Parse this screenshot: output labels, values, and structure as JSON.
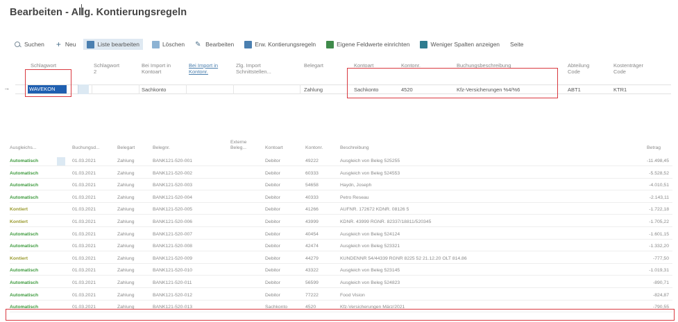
{
  "page": {
    "title": "Bearbeiten - Allg. Kontierungsregeln"
  },
  "toolbar": {
    "items": [
      {
        "label": "Suchen",
        "icon": "search-icon"
      },
      {
        "label": "Neu",
        "icon": "plus-icon"
      },
      {
        "label": "Liste bearbeiten",
        "icon": "edit-list-icon"
      },
      {
        "label": "Löschen",
        "icon": "delete-icon"
      },
      {
        "label": "Bearbeiten",
        "icon": "pencil-icon"
      },
      {
        "label": "Erw. Kontierungsregeln",
        "icon": "rules-icon"
      },
      {
        "label": "Eigene Feldwerte einrichten",
        "icon": "fields-icon"
      },
      {
        "label": "Weniger Spalten anzeigen",
        "icon": "columns-icon"
      },
      {
        "label": "Seite",
        "icon": ""
      }
    ]
  },
  "rules_table": {
    "headers": [
      "Schlagwort",
      "Schlagwort 2",
      "Bei Import in Kontoart",
      "Bei Import in Kontonr.",
      "Zlg. Import Schnittstellen...",
      "Belegart",
      "Kontoart",
      "Kontonr.",
      "Buchungsbeschreibung",
      "Abteilung Code",
      "Kostenträger Code"
    ],
    "row": {
      "schlagwort": "WAVEKON",
      "schlagwort2": "",
      "import_kontoart": "Sachkonto",
      "import_kontonr": "",
      "zlg_import": "",
      "belegart": "Zahlung",
      "kontoart": "Sachkonto",
      "kontonr": "4520",
      "beschreibung": "Kfz-Versicherungen %4/%6",
      "abteilung": "ABT1",
      "kostentraeger": "KTR1"
    }
  },
  "journal_table": {
    "headers": [
      "Ausgleichs...",
      "Buchungsd...",
      "Belegart",
      "Belegnr.",
      "Externe Beleg...",
      "Kontoart",
      "Kontonr.",
      "Beschreibung",
      "Betrag"
    ],
    "rows": [
      {
        "ausgleich": "Automatisch",
        "datum": "01.03.2021",
        "belegart": "Zahlung",
        "belegnr": "BANK121-520-001",
        "kontoart": "Debitor",
        "kontonr": "49222",
        "beschreibung": "Ausgleich von Beleg 525255",
        "betrag": "-11.498,45",
        "style": "green"
      },
      {
        "ausgleich": "Automatisch",
        "datum": "01.03.2021",
        "belegart": "Zahlung",
        "belegnr": "BANK121-520-002",
        "kontoart": "Debitor",
        "kontonr": "60333",
        "beschreibung": "Ausgleich von Beleg 524553",
        "betrag": "-5.528,52",
        "style": "green"
      },
      {
        "ausgleich": "Automatisch",
        "datum": "01.03.2021",
        "belegart": "Zahlung",
        "belegnr": "BANK121-520-003",
        "kontoart": "Debitor",
        "kontonr": "54658",
        "beschreibung": "Haydn, Joseph",
        "betrag": "-4.010,51",
        "style": "green"
      },
      {
        "ausgleich": "Automatisch",
        "datum": "01.03.2021",
        "belegart": "Zahlung",
        "belegnr": "BANK121-520-004",
        "kontoart": "Debitor",
        "kontonr": "40333",
        "beschreibung": "Petro Reseau",
        "betrag": "-2.143,11",
        "style": "green"
      },
      {
        "ausgleich": "Kontiert",
        "datum": "01.03.2021",
        "belegart": "Zahlung",
        "belegnr": "BANK121-520-005",
        "kontoart": "Debitor",
        "kontonr": "41266",
        "beschreibung": "AUFNR. 172672 KDNR. 08126 5",
        "betrag": "-1.722,18",
        "style": "olive"
      },
      {
        "ausgleich": "Kontiert",
        "datum": "01.03.2021",
        "belegart": "Zahlung",
        "belegnr": "BANK121-520-006",
        "kontoart": "Debitor",
        "kontonr": "43999",
        "beschreibung": "KDNR. 43999 RGNR. 82337/18811/520345",
        "betrag": "-1.705,22",
        "style": "olive"
      },
      {
        "ausgleich": "Automatisch",
        "datum": "01.03.2021",
        "belegart": "Zahlung",
        "belegnr": "BANK121-520-007",
        "kontoart": "Debitor",
        "kontonr": "40454",
        "beschreibung": "Ausgleich von Beleg 524124",
        "betrag": "-1.601,15",
        "style": "green"
      },
      {
        "ausgleich": "Automatisch",
        "datum": "01.03.2021",
        "belegart": "Zahlung",
        "belegnr": "BANK121-520-008",
        "kontoart": "Debitor",
        "kontonr": "42474",
        "beschreibung": "Ausgleich von Beleg 523321",
        "betrag": "-1.332,20",
        "style": "green"
      },
      {
        "ausgleich": "Kontiert",
        "datum": "01.03.2021",
        "belegart": "Zahlung",
        "belegnr": "BANK121-520-009",
        "kontoart": "Debitor",
        "kontonr": "44279",
        "beschreibung": "KUNDENNR 54/44339 RGNR 8225 52 21.12.20 OLT 814.86",
        "betrag": "-777,50",
        "style": "olive"
      },
      {
        "ausgleich": "Automatisch",
        "datum": "01.03.2021",
        "belegart": "Zahlung",
        "belegnr": "BANK121-520-010",
        "kontoart": "Debitor",
        "kontonr": "43322",
        "beschreibung": "Ausgleich von Beleg 523145",
        "betrag": "-1.019,31",
        "style": "green"
      },
      {
        "ausgleich": "Automatisch",
        "datum": "01.03.2021",
        "belegart": "Zahlung",
        "belegnr": "BANK121-520-011",
        "kontoart": "Debitor",
        "kontonr": "56599",
        "beschreibung": "Ausgleich von Beleg 524823",
        "betrag": "-890,71",
        "style": "green"
      },
      {
        "ausgleich": "Automatisch",
        "datum": "01.03.2021",
        "belegart": "Zahlung",
        "belegnr": "BANK121-520-012",
        "kontoart": "Debitor",
        "kontonr": "77222",
        "beschreibung": "Food Vision",
        "betrag": "-824,87",
        "style": "green"
      },
      {
        "ausgleich": "Automatisch",
        "datum": "01.03.2021",
        "belegart": "Zahlung",
        "belegnr": "BANK121-520-013",
        "kontoart": "Sachkonto",
        "kontonr": "4520",
        "beschreibung": "Kfz-Versicherungen März/2021",
        "betrag": "-790,55",
        "style": "green"
      }
    ]
  },
  "colors": {
    "accent": "#1f5fb0",
    "highlight": "#d9383f",
    "automatic": "#3d9a3d",
    "assigned": "#9a9a2e"
  }
}
